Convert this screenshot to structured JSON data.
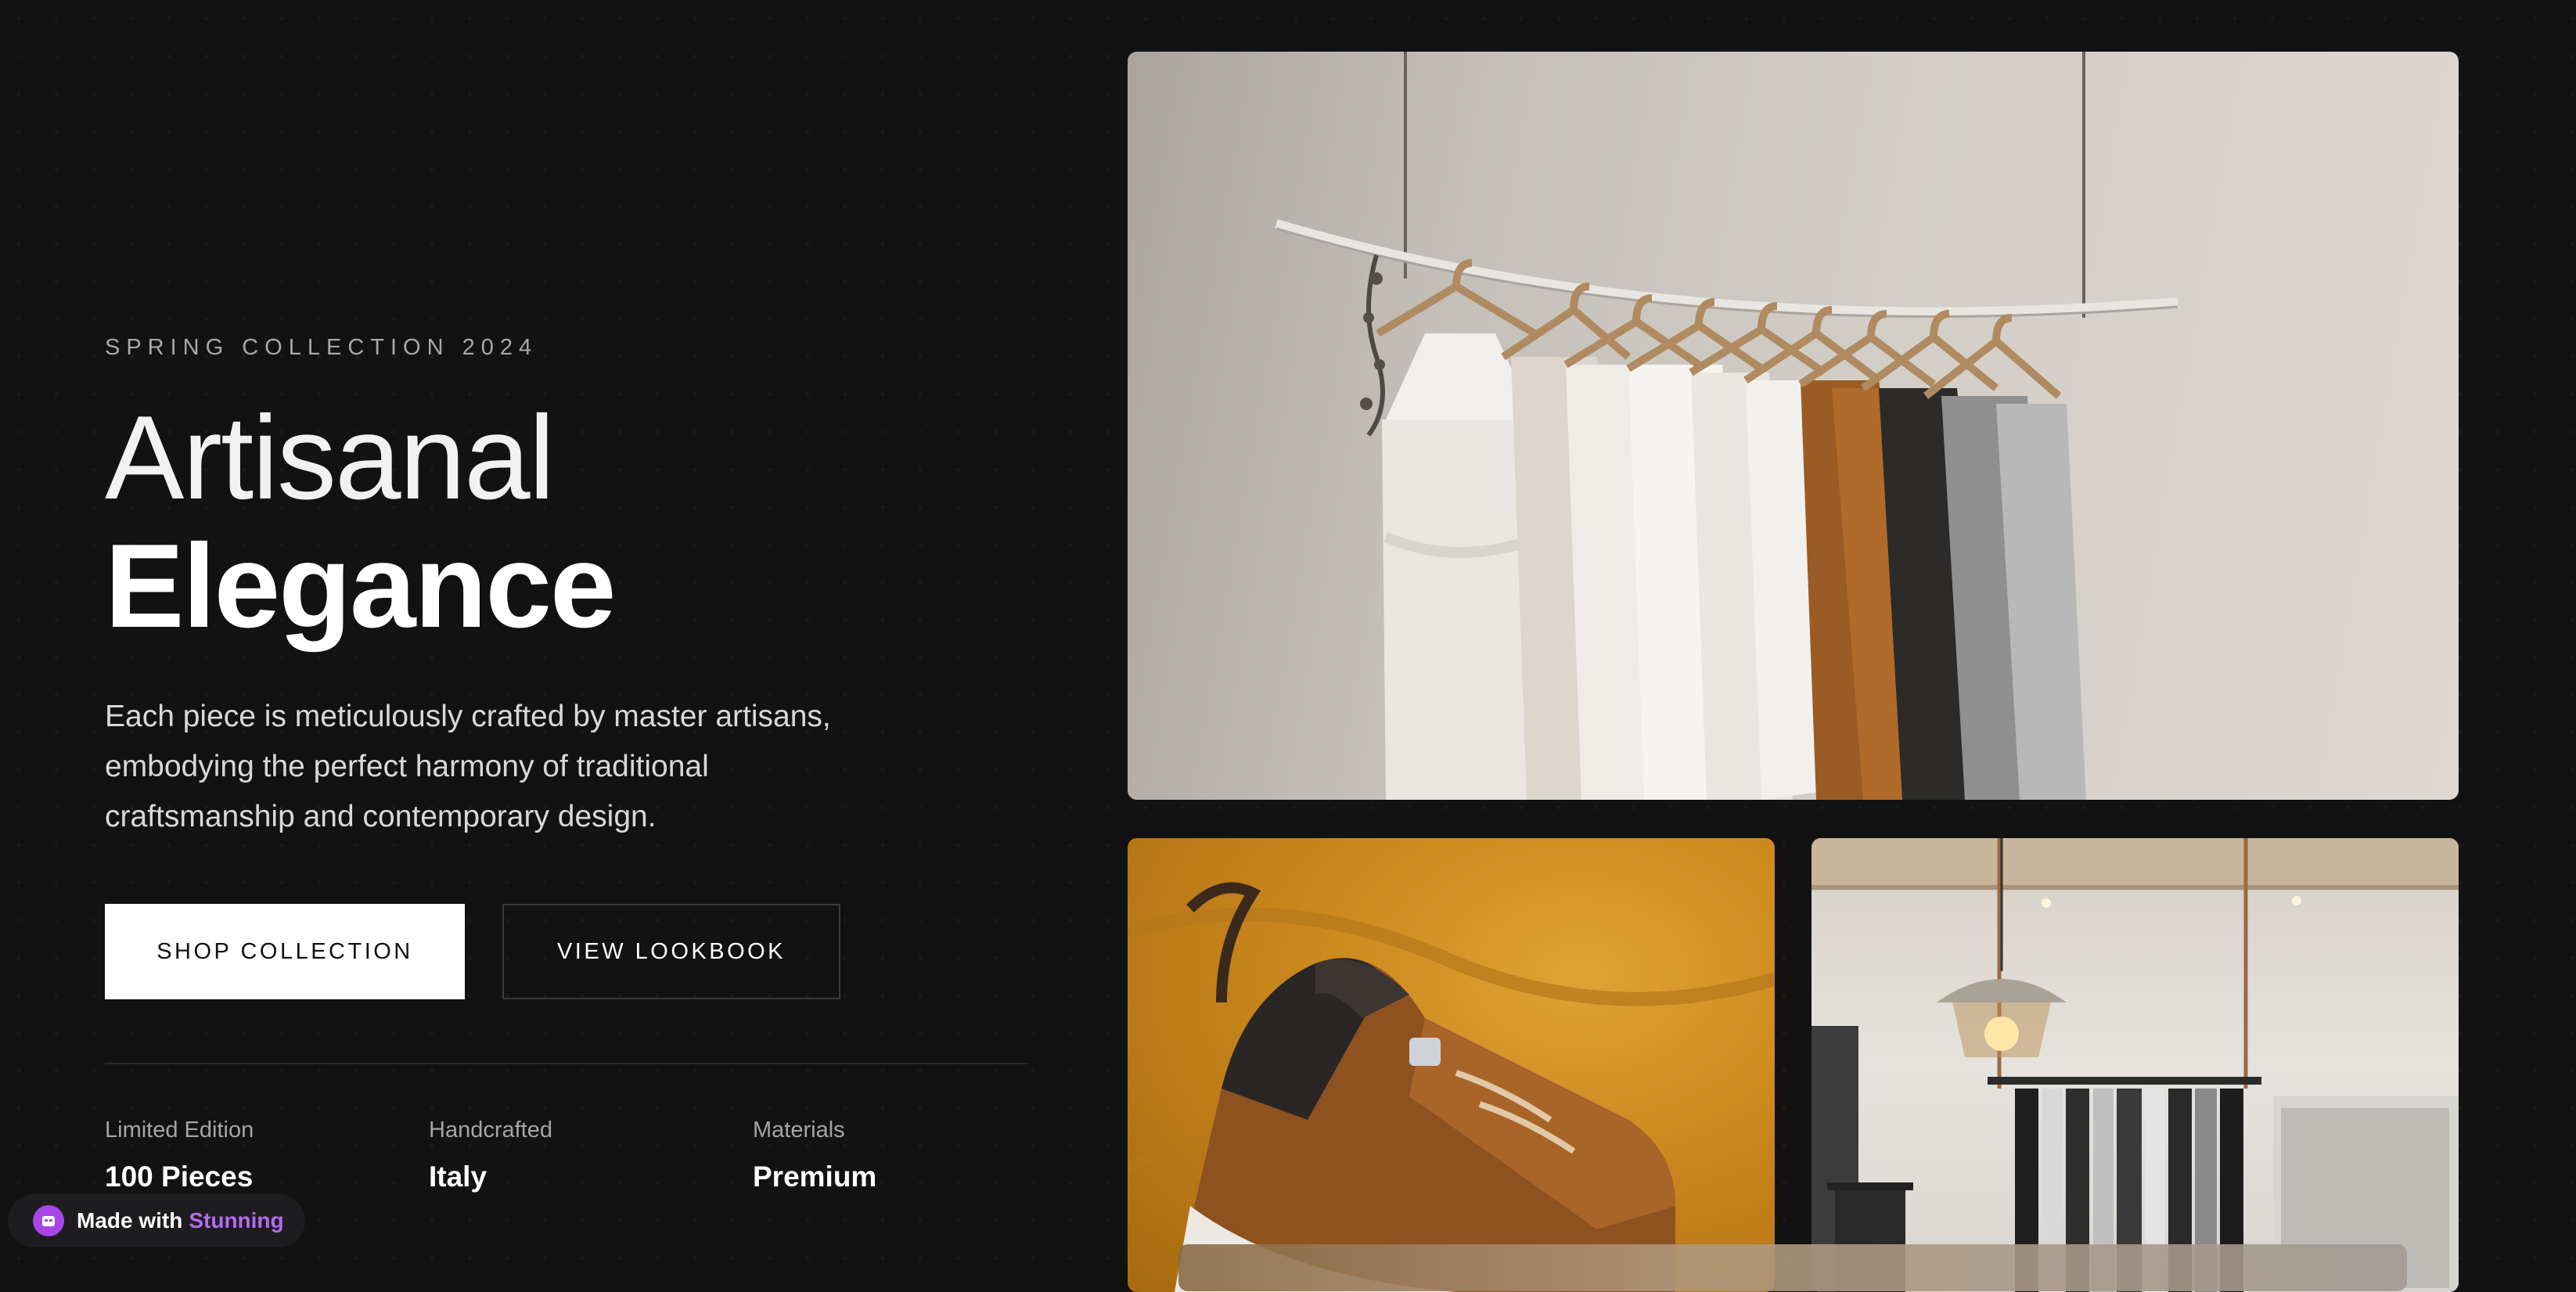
{
  "hero": {
    "eyebrow": "SPRING COLLECTION 2024",
    "title_line1": "Artisanal",
    "title_line2": "Elegance",
    "description": "Each piece is meticulously crafted by master artisans, embodying the perfect harmony of traditional craftsmanship and contemporary design.",
    "primary_button": "SHOP COLLECTION",
    "secondary_button": "VIEW LOOKBOOK"
  },
  "stats": [
    {
      "label": "Limited Edition",
      "value": "100 Pieces"
    },
    {
      "label": "Handcrafted",
      "value": "Italy"
    },
    {
      "label": "Materials",
      "value": "Premium"
    }
  ],
  "badge": {
    "prefix": "Made with",
    "brand": "Stunning"
  },
  "colors": {
    "background": "#121213",
    "accent": "#b46af2",
    "primary_button_bg": "#ffffff"
  },
  "images": [
    "clothing-rack-photo",
    "sneaker-photo",
    "boutique-interior-photo"
  ]
}
